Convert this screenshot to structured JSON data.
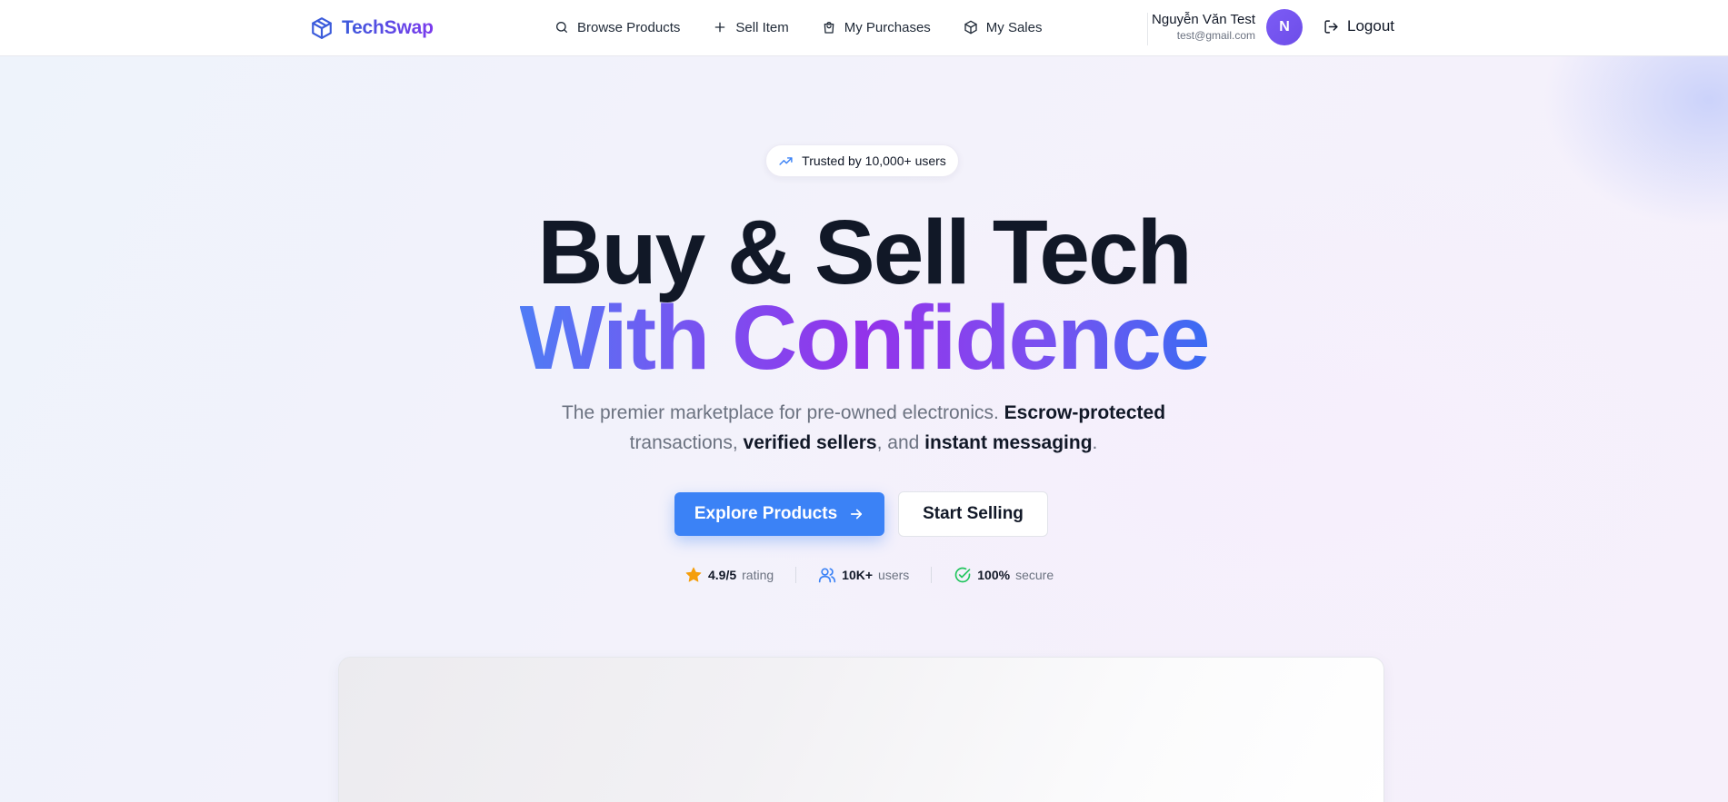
{
  "brand": {
    "name": "TechSwap"
  },
  "nav": {
    "items": [
      {
        "label": "Browse Products",
        "icon": "search-icon"
      },
      {
        "label": "Sell Item",
        "icon": "plus-icon"
      },
      {
        "label": "My Purchases",
        "icon": "shopping-bag-icon"
      },
      {
        "label": "My Sales",
        "icon": "package-icon"
      }
    ]
  },
  "user": {
    "name": "Nguyễn Văn Test",
    "email": "test@gmail.com",
    "avatar_initial": "N",
    "logout_label": "Logout"
  },
  "hero": {
    "badge": "Trusted by 10,000+ users",
    "title_line1": "Buy & Sell Tech",
    "title_line2": "With Confidence",
    "subtitle": {
      "t1": "The premier marketplace for pre-owned electronics. ",
      "b1": "Escrow-protected",
      "t2": " transactions, ",
      "b2": "verified sellers",
      "t3": ", and ",
      "b3": "instant messaging",
      "t4": "."
    },
    "primary_cta": "Explore Products",
    "secondary_cta": "Start Selling"
  },
  "stats": [
    {
      "value": "4.9/5",
      "label": "rating",
      "icon": "star-icon",
      "color": "#f59e0b"
    },
    {
      "value": "10K+",
      "label": "users",
      "icon": "users-icon",
      "color": "#3b82f6"
    },
    {
      "value": "100%",
      "label": "secure",
      "icon": "check-circle-icon",
      "color": "#22c55e"
    }
  ],
  "colors": {
    "accent": "#3b82f6",
    "brand_gradient_start": "#3b5bdb",
    "brand_gradient_end": "#7c3aed",
    "avatar": "#7c5cf6"
  }
}
